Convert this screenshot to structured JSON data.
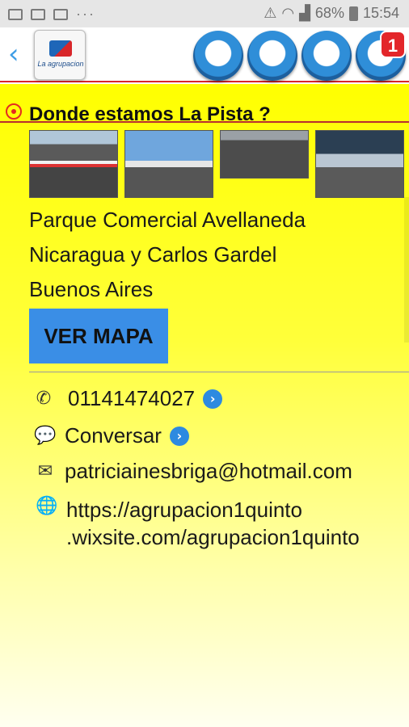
{
  "status_bar": {
    "battery": "68%",
    "time": "15:54",
    "dots": "···"
  },
  "header": {
    "back_icon": "‹",
    "logo_text": "La agrupacion",
    "buttons": [
      {
        "name": "facebook-icon",
        "glyph": "f"
      },
      {
        "name": "mail-icon",
        "glyph": "✉"
      },
      {
        "name": "chevron-down-icon",
        "glyph": "⌄"
      },
      {
        "name": "signal-icon",
        "glyph": "⦿"
      }
    ],
    "badge": "1"
  },
  "section": {
    "title": "Donde estamos La Pista ?",
    "address": [
      "Parque Comercial Avellaneda",
      "Nicaragua y Carlos Gardel",
      "Buenos Aires"
    ],
    "map_button": "VER MAPA"
  },
  "contacts": {
    "phone": "01141474027",
    "chat": "Conversar",
    "email": "patriciainesbriga@hotmail.com",
    "website": "https://agrupacion1quinto\n.wixsite.com/agrupacion1quinto"
  },
  "colors": {
    "accent": "#3a8ee6",
    "background": "#ffff00",
    "divider": "#b7302f"
  }
}
